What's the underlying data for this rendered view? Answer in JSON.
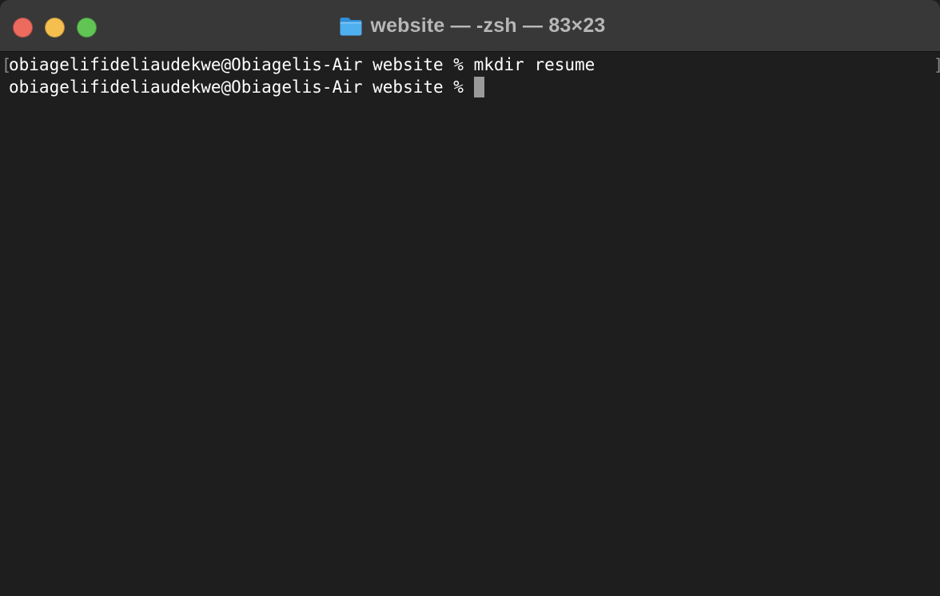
{
  "window": {
    "title": "website — -zsh — 83×23",
    "title_icon": "folder-icon",
    "buttons": {
      "close_color": "#ed6a5e",
      "minimize_color": "#f5bf4f",
      "zoom_color": "#61c554"
    }
  },
  "terminal": {
    "background": "#1e1e1e",
    "foreground": "#ffffff",
    "lines": [
      "obiagelifideliaudekwe@Obiagelis-Air website % mkdir resume",
      "obiagelifideliaudekwe@Obiagelis-Air website % "
    ],
    "selection_marks": {
      "left": "[",
      "right": "]"
    }
  }
}
